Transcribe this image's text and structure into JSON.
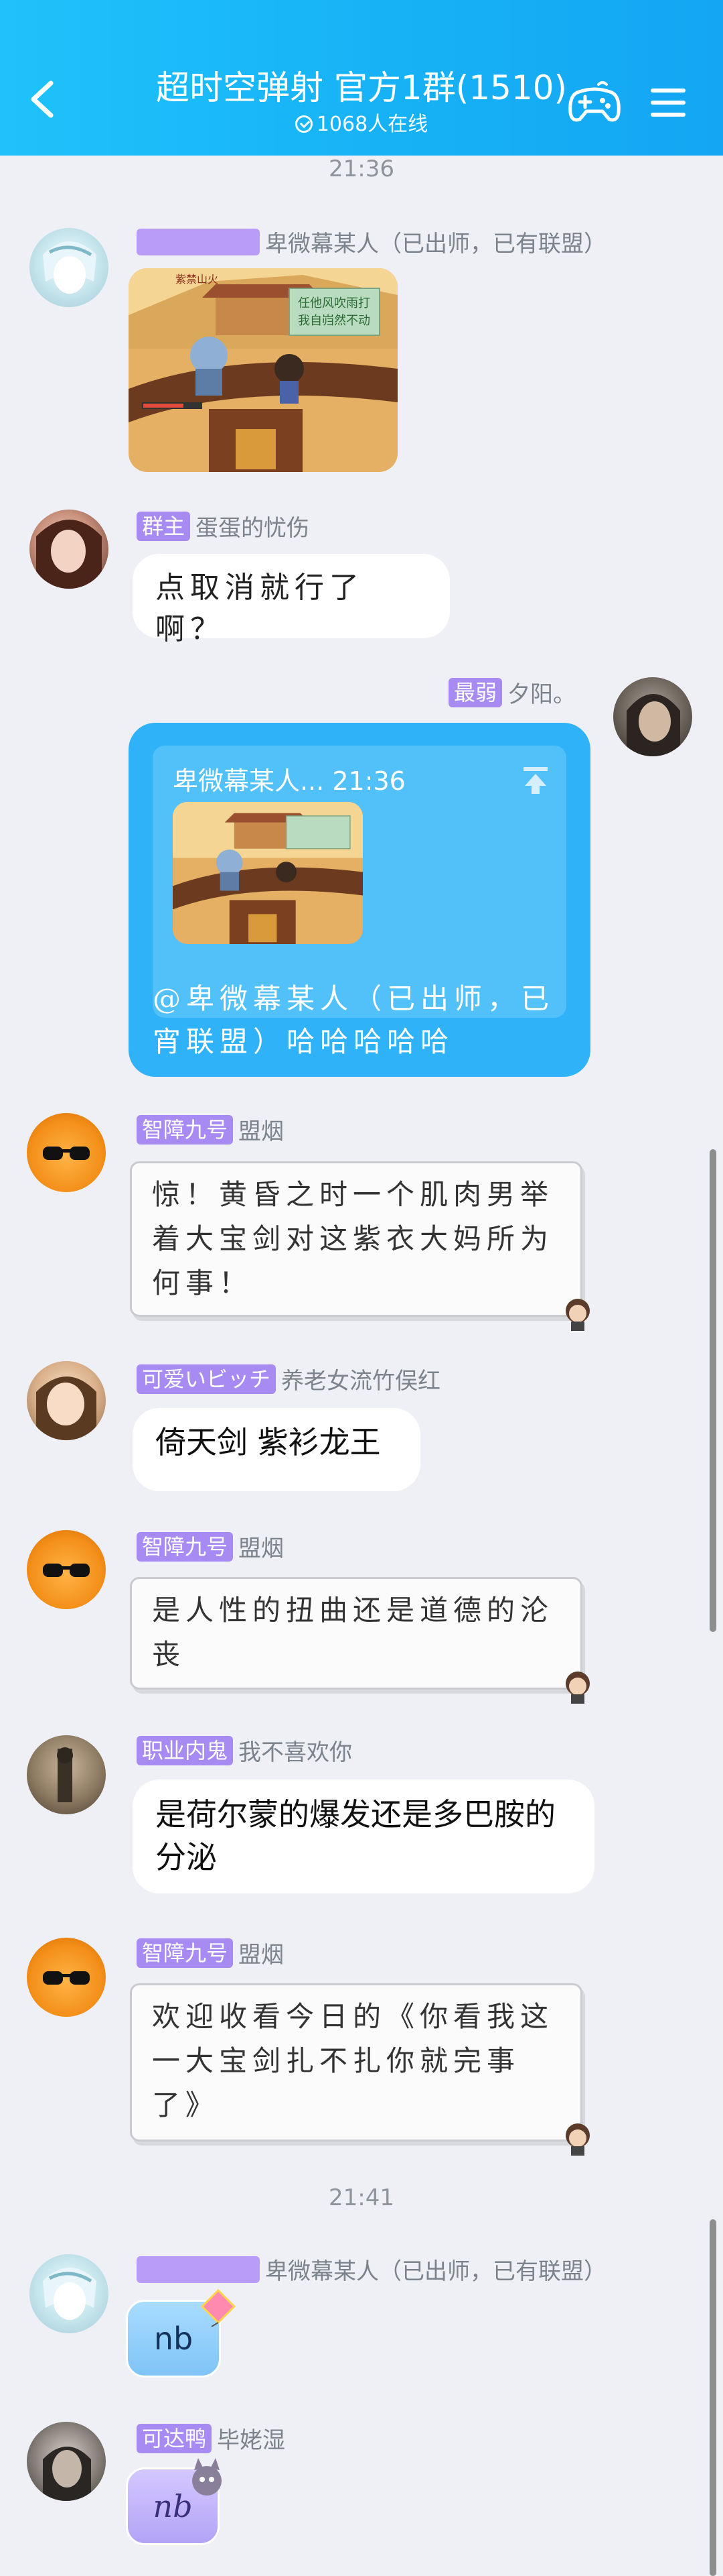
{
  "header": {
    "title": "超时空弹射 官方1群(1510)",
    "online": "1068人在线"
  },
  "timestamps": [
    "21:36",
    "21:41"
  ],
  "messages": [
    {
      "tag": "",
      "name": "卑微幕某人（已出师，已有联盟）"
    },
    {
      "tag": "群主",
      "name": "蛋蛋的忧伤",
      "text": "点取消就行了啊？"
    },
    {
      "tag": "最弱",
      "name": "夕阳。",
      "quote_header": "卑微幕某人... 21:36",
      "text": "@卑微幕某人（已出师，已宵联盟）哈哈哈哈哈"
    },
    {
      "tag": "智障九号",
      "name": "盟烟",
      "text": "惊！黄昏之时一个肌肉男举着大宝剑对这紫衣大妈所为何事！"
    },
    {
      "tag": "可爱いビッチ",
      "name": "养老女流竹俣红",
      "text": "倚天剑 紫衫龙王"
    },
    {
      "tag": "智障九号",
      "name": "盟烟",
      "text": "是人性的扭曲还是道德的沦丧"
    },
    {
      "tag": "职业内鬼",
      "name": "我不喜欢你",
      "text": "是荷尔蒙的爆发还是多巴胺的分泌"
    },
    {
      "tag": "智障九号",
      "name": "盟烟",
      "text": "欢迎收看今日的《你看我这一大宝剑扎不扎你就完事了》"
    },
    {
      "tag": "",
      "name": "卑微幕某人（已出师，已有联盟）",
      "text": "nb"
    },
    {
      "tag": "可达鸭",
      "name": "毕姥湿",
      "text": "nb"
    }
  ],
  "game_image": {
    "top_label": "紫禁山火",
    "board_text": "任他风吹雨打\n我自岿然不动"
  },
  "colors": {
    "header": "#1fc2fb",
    "tag": "#a78bf2",
    "blue_bubble": "#2fb2f7",
    "background": "#eef0f5"
  }
}
